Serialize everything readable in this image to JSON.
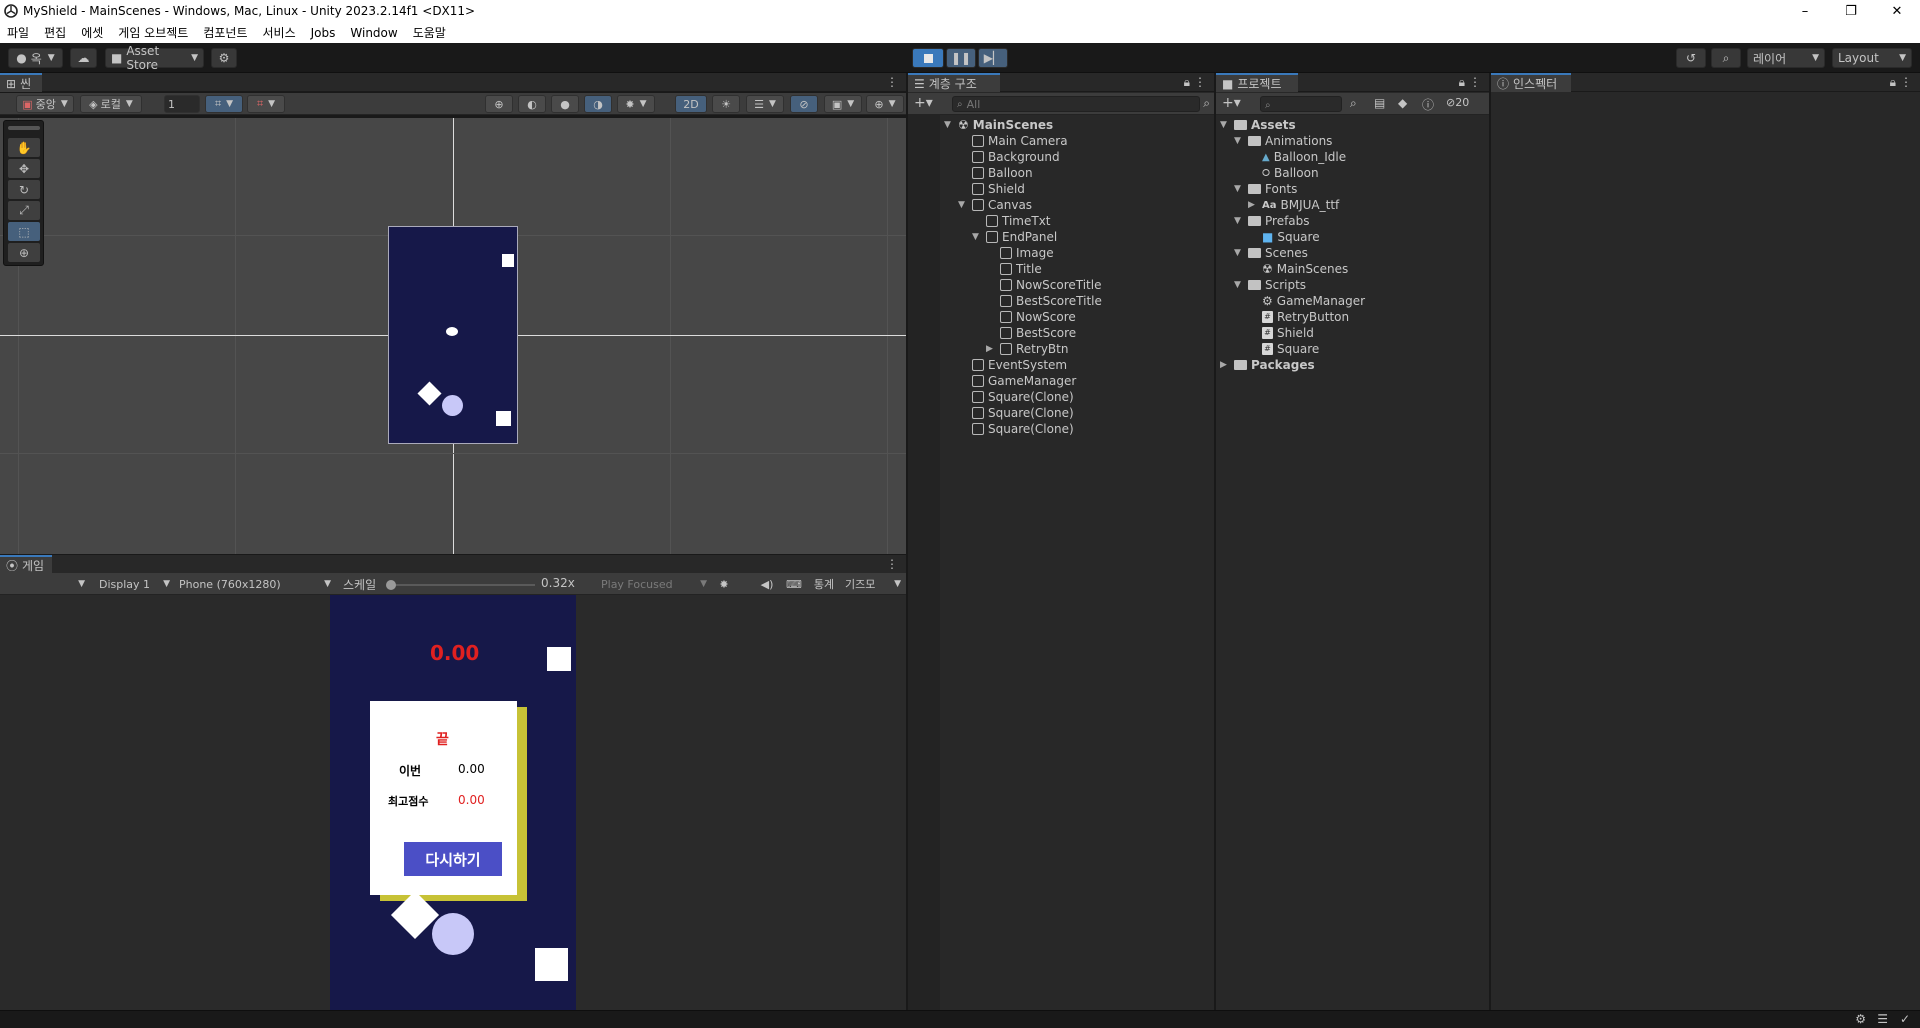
{
  "window": {
    "title": "MyShield - MainScenes - Windows, Mac, Linux - Unity 2023.2.14f1 <DX11>"
  },
  "menu": [
    "파일",
    "편집",
    "에셋",
    "게임 오브젝트",
    "컴포넌트",
    "서비스",
    "Jobs",
    "Window",
    "도움말"
  ],
  "toolbar": {
    "account": "옥",
    "asset_store": "Asset Store",
    "layers": "레이어",
    "layout": "Layout"
  },
  "scene": {
    "tab": "씬",
    "pivot": "중앙",
    "space": "로컬",
    "snap_value": "1",
    "mode_2d": "2D"
  },
  "game": {
    "tab": "게임",
    "display": "Display 1",
    "resolution": "Phone (760x1280)",
    "scale_label": "스케일",
    "scale_value": "0.32x",
    "scale_fraction": 0.0,
    "play_mode": "Play Focused",
    "stats": "통계",
    "gizmos": "기즈모",
    "score": "0.00",
    "end_title": "끝",
    "now_label": "이번",
    "now_value": "0.00",
    "best_label": "최고점수",
    "best_value": "0.00",
    "retry": "다시하기"
  },
  "hierarchy": {
    "tab": "계층 구조",
    "search_placeholder": "All",
    "items": [
      {
        "name": "MainScenes",
        "depth": 0,
        "expanded": true,
        "kind": "scene"
      },
      {
        "name": "Main Camera",
        "depth": 1,
        "kind": "object"
      },
      {
        "name": "Background",
        "depth": 1,
        "kind": "object"
      },
      {
        "name": "Balloon",
        "depth": 1,
        "kind": "object"
      },
      {
        "name": "Shield",
        "depth": 1,
        "kind": "object"
      },
      {
        "name": "Canvas",
        "depth": 1,
        "expanded": true,
        "kind": "object"
      },
      {
        "name": "TimeTxt",
        "depth": 2,
        "kind": "object"
      },
      {
        "name": "EndPanel",
        "depth": 2,
        "expanded": true,
        "kind": "object"
      },
      {
        "name": "Image",
        "depth": 3,
        "kind": "object"
      },
      {
        "name": "Title",
        "depth": 3,
        "kind": "object"
      },
      {
        "name": "NowScoreTitle",
        "depth": 3,
        "kind": "object"
      },
      {
        "name": "BestScoreTitle",
        "depth": 3,
        "kind": "object"
      },
      {
        "name": "NowScore",
        "depth": 3,
        "kind": "object"
      },
      {
        "name": "BestScore",
        "depth": 3,
        "kind": "object"
      },
      {
        "name": "RetryBtn",
        "depth": 3,
        "expanded": false,
        "kind": "object"
      },
      {
        "name": "EventSystem",
        "depth": 1,
        "kind": "object"
      },
      {
        "name": "GameManager",
        "depth": 1,
        "kind": "object"
      },
      {
        "name": "Square(Clone)",
        "depth": 1,
        "kind": "object"
      },
      {
        "name": "Square(Clone)",
        "depth": 1,
        "kind": "object"
      },
      {
        "name": "Square(Clone)",
        "depth": 1,
        "kind": "object"
      }
    ]
  },
  "project": {
    "tab": "프로젝트",
    "hidden_count": "20",
    "items": [
      {
        "name": "Assets",
        "depth": 0,
        "kind": "folder",
        "bold": true,
        "expanded": true
      },
      {
        "name": "Animations",
        "depth": 1,
        "kind": "folder",
        "expanded": true
      },
      {
        "name": "Balloon_Idle",
        "depth": 2,
        "kind": "anim"
      },
      {
        "name": "Balloon",
        "depth": 2,
        "kind": "controller"
      },
      {
        "name": "Fonts",
        "depth": 1,
        "kind": "folder",
        "expanded": true
      },
      {
        "name": "BMJUA_ttf",
        "depth": 2,
        "kind": "font",
        "collapsed": true
      },
      {
        "name": "Prefabs",
        "depth": 1,
        "kind": "folder",
        "expanded": true
      },
      {
        "name": "Square",
        "depth": 2,
        "kind": "prefab"
      },
      {
        "name": "Scenes",
        "depth": 1,
        "kind": "folder",
        "expanded": true
      },
      {
        "name": "MainScenes",
        "depth": 2,
        "kind": "scene"
      },
      {
        "name": "Scripts",
        "depth": 1,
        "kind": "folder",
        "expanded": true
      },
      {
        "name": "GameManager",
        "depth": 2,
        "kind": "gear"
      },
      {
        "name": "RetryButton",
        "depth": 2,
        "kind": "script"
      },
      {
        "name": "Shield",
        "depth": 2,
        "kind": "script"
      },
      {
        "name": "Square",
        "depth": 2,
        "kind": "script"
      },
      {
        "name": "Packages",
        "depth": 0,
        "kind": "folder",
        "bold": true,
        "collapsed": true
      }
    ]
  },
  "inspector": {
    "tab": "인스펙터"
  },
  "colors": {
    "accent": "#3a79bb",
    "game_bg": "#161849",
    "score_red": "#e02020",
    "retry_bg": "#4b4fc6"
  }
}
